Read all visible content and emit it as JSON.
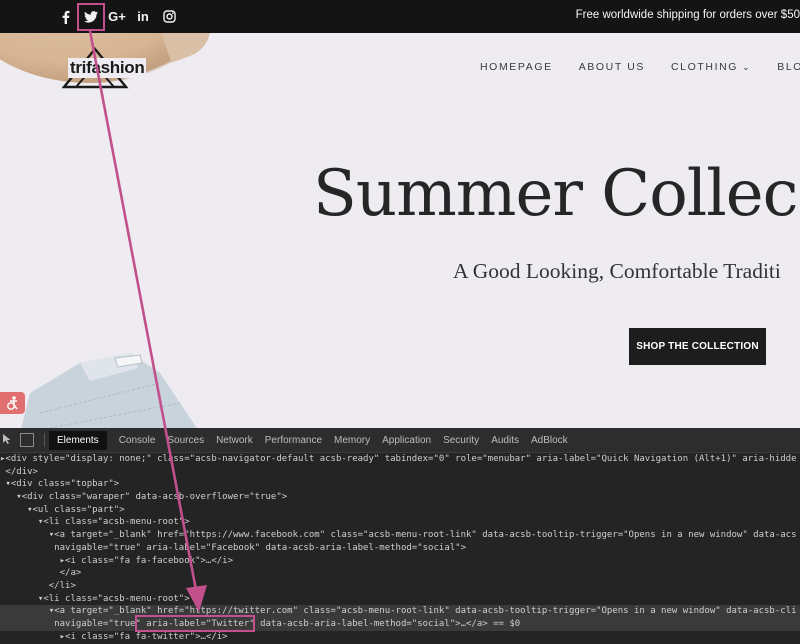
{
  "topbar": {
    "social": [
      {
        "name": "facebook-icon",
        "glyph": "f"
      },
      {
        "name": "twitter-icon",
        "glyph": ""
      },
      {
        "name": "google-plus-icon",
        "glyph": "G+"
      },
      {
        "name": "linkedin-icon",
        "glyph": "in"
      },
      {
        "name": "instagram-icon",
        "glyph": ""
      }
    ],
    "shipping_text": "Free worldwide shipping for orders over $50"
  },
  "hero": {
    "logo_text": "trifashion",
    "nav": [
      "HOMEPAGE",
      "ABOUT US",
      "CLOTHING",
      "BLOG"
    ],
    "title": "Summer Collec",
    "subtitle": "A Good Looking, Comfortable Traditi",
    "cta": "SHOP THE COLLECTION"
  },
  "devtools": {
    "tabs": [
      "Elements",
      "Console",
      "Sources",
      "Network",
      "Performance",
      "Memory",
      "Application",
      "Security",
      "Audits",
      "AdBlock"
    ],
    "active_tab": "Elements",
    "lines": [
      "▸<div style=\"display: none;\" class=\"acsb-navigator-default acsb-ready\" tabindex=\"0\" role=\"menubar\" aria-label=\"Quick Navigation (Alt+1)\" aria-hidde",
      " </div>",
      " ▾<div class=\"topbar\">",
      "   ▾<div class=\"waraper\" data-acsb-overflower=\"true\">",
      "     ▾<ul class=\"part\">",
      "       ▾<li class=\"acsb-menu-root\">",
      "         ▾<a target=\"_blank\" href=\"https://www.facebook.com\" class=\"acsb-menu-root-link\" data-acsb-tooltip-trigger=\"Opens in a new window\" data-acs",
      "          navigable=\"true\" aria-label=\"Facebook\" data-acsb-aria-label-method=\"social\">",
      "           ▸<i class=\"fa fa-facebook\">…</i>",
      "           </a>",
      "         </li>",
      "       ▾<li class=\"acsb-menu-root\">",
      "         ▾<a target=\"_blank\" href=\"https://twitter.com\" class=\"acsb-menu-root-link\" data-acsb-tooltip-trigger=\"Opens in a new window\" data-acsb-cli",
      "          navigable=\"true\" aria-label=\"Twitter\" data-acsb-aria-label-method=\"social\">…</a> == $0",
      "           ▸<i class=\"fa fa-twitter\">…</i>"
    ],
    "highlight_text": "aria-label=\"Twitter\""
  },
  "annotation": {
    "color": "#c2508d"
  }
}
